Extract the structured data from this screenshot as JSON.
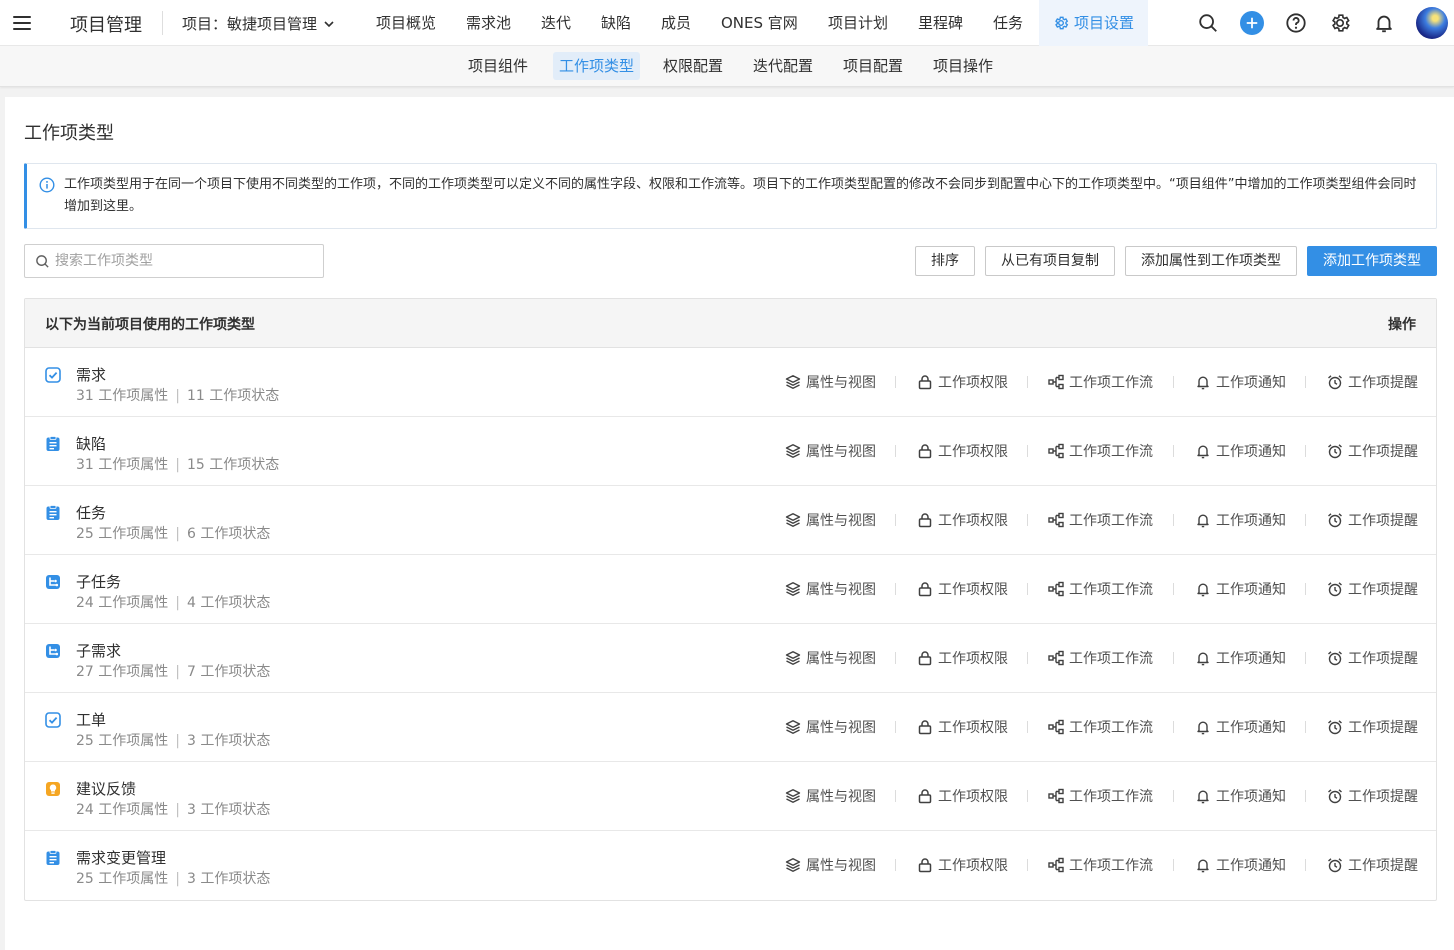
{
  "topbar": {
    "app_title": "项目管理",
    "project_label": "项目：敏捷项目管理",
    "nav": [
      {
        "label": "项目概览"
      },
      {
        "label": "需求池"
      },
      {
        "label": "迭代"
      },
      {
        "label": "缺陷"
      },
      {
        "label": "成员"
      },
      {
        "label": "ONES 官网"
      },
      {
        "label": "项目计划"
      },
      {
        "label": "里程碑"
      },
      {
        "label": "任务"
      },
      {
        "label": "项目设置",
        "active": true
      }
    ],
    "accent_color": "#338fe5"
  },
  "subnav": {
    "items": [
      {
        "label": "项目组件"
      },
      {
        "label": "工作项类型",
        "active": true
      },
      {
        "label": "权限配置"
      },
      {
        "label": "迭代配置"
      },
      {
        "label": "项目配置"
      },
      {
        "label": "项目操作"
      }
    ]
  },
  "page": {
    "title": "工作项类型",
    "notice": "工作项类型用于在同一个项目下使用不同类型的工作项，不同的工作项类型可以定义不同的属性字段、权限和工作流等。项目下的工作项类型配置的修改不会同步到配置中心下的工作项类型中。“项目组件”中增加的工作项类型组件会同时增加到这里。",
    "search_placeholder": "搜索工作项类型",
    "buttons": {
      "sort": "排序",
      "copy": "从已有项目复制",
      "add_attr": "添加属性到工作项类型",
      "add_type": "添加工作项类型"
    }
  },
  "table": {
    "header_left": "以下为当前项目使用的工作项类型",
    "header_right": "操作",
    "actions": [
      "属性与视图",
      "工作项权限",
      "工作项工作流",
      "工作项通知",
      "工作项提醒"
    ],
    "rows": [
      {
        "name": "需求",
        "attrs": "31 工作项属性",
        "states": "11 工作项状态",
        "icon": "check-square-icon",
        "color": "#338fe5"
      },
      {
        "name": "缺陷",
        "attrs": "31 工作项属性",
        "states": "15 工作项状态",
        "icon": "clipboard-icon",
        "color": "#338fe5"
      },
      {
        "name": "任务",
        "attrs": "25 工作项属性",
        "states": "6 工作项状态",
        "icon": "clipboard-icon",
        "color": "#338fe5"
      },
      {
        "name": "子任务",
        "attrs": "24 工作项属性",
        "states": "4 工作项状态",
        "icon": "subtask-icon",
        "color": "#338fe5"
      },
      {
        "name": "子需求",
        "attrs": "27 工作项属性",
        "states": "7 工作项状态",
        "icon": "subtask-icon",
        "color": "#338fe5"
      },
      {
        "name": "工单",
        "attrs": "25 工作项属性",
        "states": "3 工作项状态",
        "icon": "check-square-icon",
        "color": "#338fe5"
      },
      {
        "name": "建议反馈",
        "attrs": "24 工作项属性",
        "states": "3 工作项状态",
        "icon": "lightbulb-icon",
        "color": "#f5a623"
      },
      {
        "name": "需求变更管理",
        "attrs": "25 工作项属性",
        "states": "3 工作项状态",
        "icon": "clipboard-icon",
        "color": "#338fe5"
      }
    ]
  }
}
